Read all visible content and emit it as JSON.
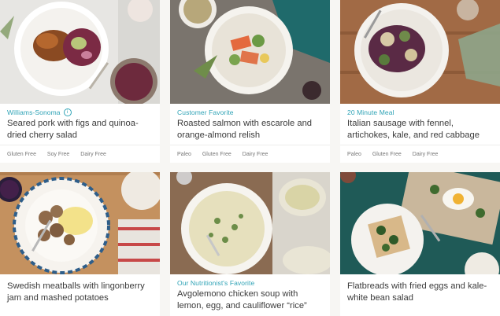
{
  "recipes": [
    {
      "tag": "Williams-Sonoma",
      "title": "Seared pork with figs and quinoa-dried cherry salad",
      "diets": [
        "Gluten Free",
        "Soy Free",
        "Dairy Free"
      ],
      "info_icon": "info-icon",
      "photo_bg": "#e7e6e3"
    },
    {
      "tag": "Customer Favorite",
      "title": "Roasted salmon with escarole and orange-almond relish",
      "diets": [
        "Paleo",
        "Gluten Free",
        "Dairy Free"
      ],
      "photo_bg": "#6b6560"
    },
    {
      "tag": "20 Minute Meal",
      "title": "Italian sausage with fennel, artichokes, kale, and red cabbage",
      "diets": [
        "Paleo",
        "Gluten Free",
        "Dairy Free"
      ],
      "photo_bg": "#a16a45"
    },
    {
      "tag": "",
      "title": "Swedish meatballs with lingonberry jam and mashed potatoes",
      "diets": [],
      "photo_bg": "#c4915f"
    },
    {
      "tag": "Our Nutritionist's Favorite",
      "title": "Avgolemono chicken soup with lemon, egg, and cauliflower “rice”",
      "diets": [],
      "photo_bg": "#8a6b52"
    },
    {
      "tag": "",
      "title": "Flatbreads with fried eggs and kale-white bean salad",
      "diets": [],
      "photo_bg": "#1f5a57"
    }
  ],
  "colors": {
    "accent": "#2fa3b6",
    "title_text": "#3b3b3b",
    "diet_text": "#777777",
    "page_bg": "#f7f6f3"
  }
}
